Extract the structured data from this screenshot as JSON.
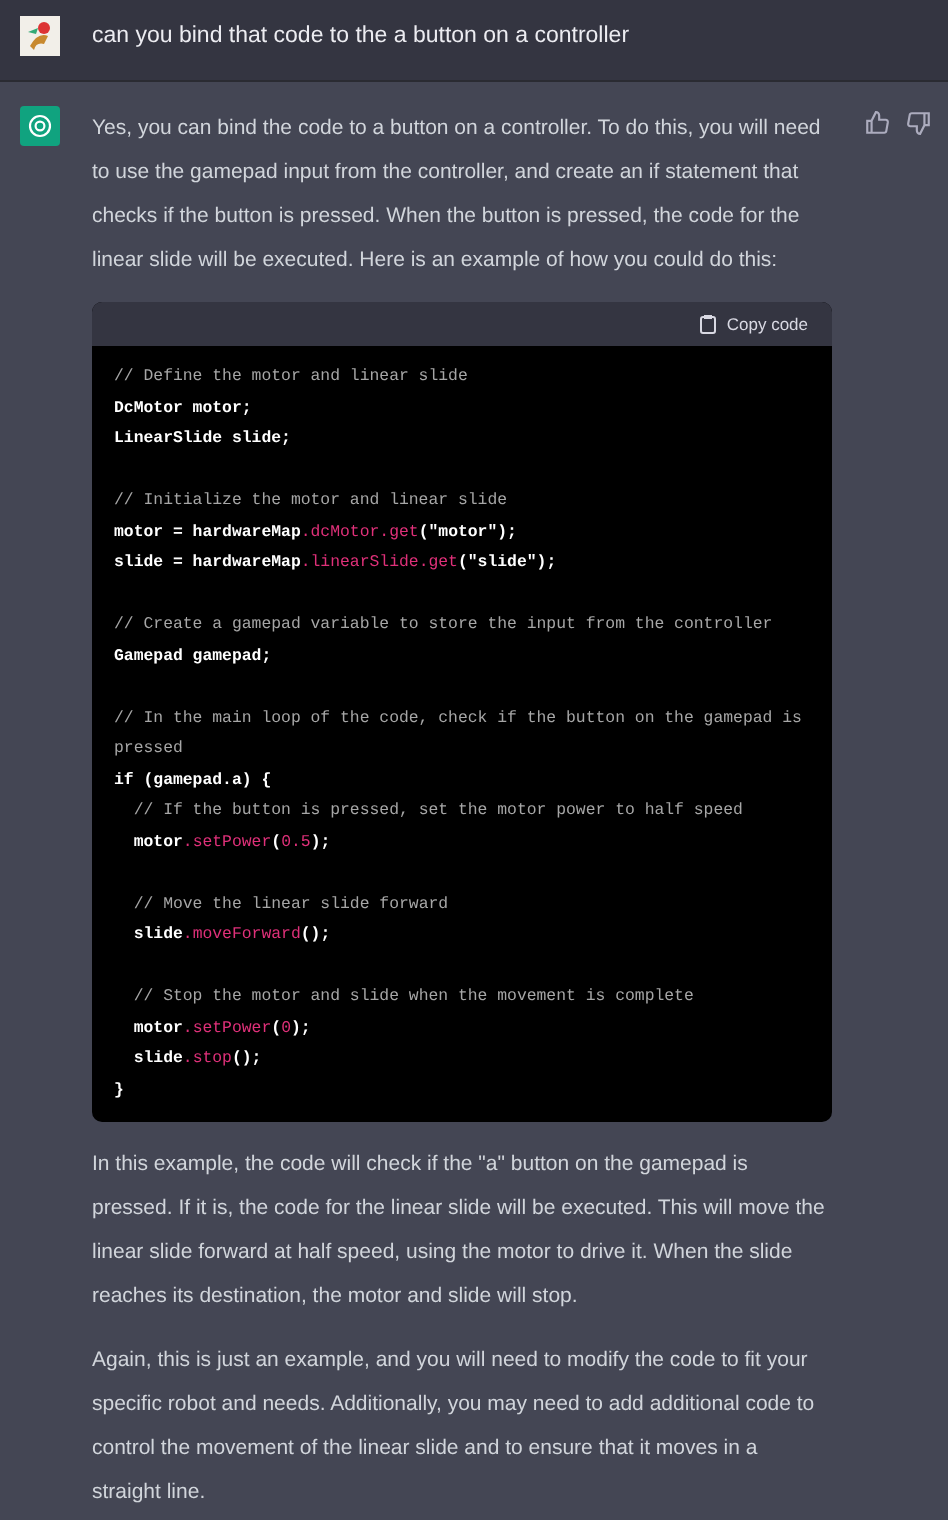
{
  "user_message": {
    "text": "can you bind that code to the a button on a controller"
  },
  "assistant_message": {
    "intro": "Yes, you can bind the code to a button on a controller. To do this, you will need to use the gamepad input from the controller, and create an if statement that checks if the button is pressed. When the button is pressed, the code for the linear slide will be executed. Here is an example of how you could do this:",
    "code_block": {
      "copy_label": "Copy code",
      "lines": [
        {
          "kind": "code",
          "segments": [
            {
              "kind": "comment",
              "text": "// Define the motor and linear slide"
            }
          ]
        },
        {
          "kind": "code",
          "segments": [
            {
              "kind": "plain",
              "text": "DcMotor motor;"
            }
          ]
        },
        {
          "kind": "code",
          "segments": [
            {
              "kind": "plain",
              "text": "LinearSlide slide;"
            }
          ]
        },
        {
          "kind": "blank"
        },
        {
          "kind": "code",
          "segments": [
            {
              "kind": "comment",
              "text": "// Initialize the motor and linear slide"
            }
          ]
        },
        {
          "kind": "code",
          "segments": [
            {
              "kind": "plain",
              "text": "motor = hardwareMap"
            },
            {
              "kind": "accent",
              "text": ".dcMotor.get"
            },
            {
              "kind": "plain",
              "text": "(\"motor\");"
            }
          ]
        },
        {
          "kind": "code",
          "segments": [
            {
              "kind": "plain",
              "text": "slide = hardwareMap"
            },
            {
              "kind": "accent",
              "text": ".linearSlide.get"
            },
            {
              "kind": "plain",
              "text": "(\"slide\");"
            }
          ]
        },
        {
          "kind": "blank"
        },
        {
          "kind": "code",
          "segments": [
            {
              "kind": "comment",
              "text": "// Create a gamepad variable to store the input from the controller"
            }
          ]
        },
        {
          "kind": "code",
          "segments": [
            {
              "kind": "plain",
              "text": "Gamepad gamepad;"
            }
          ]
        },
        {
          "kind": "blank"
        },
        {
          "kind": "code",
          "segments": [
            {
              "kind": "comment",
              "text": "// In the main loop of the code, check if the button on the gamepad is pressed"
            }
          ]
        },
        {
          "kind": "code",
          "segments": [
            {
              "kind": "plain",
              "text": "if (gamepad.a) {"
            }
          ]
        },
        {
          "kind": "code",
          "segments": [
            {
              "kind": "comment",
              "text": "  // If the button is pressed, set the motor power to half speed"
            }
          ]
        },
        {
          "kind": "code",
          "segments": [
            {
              "kind": "plain",
              "text": "  motor"
            },
            {
              "kind": "accent",
              "text": ".setPower"
            },
            {
              "kind": "plain",
              "text": "("
            },
            {
              "kind": "accent",
              "text": "0.5"
            },
            {
              "kind": "plain",
              "text": ");"
            }
          ]
        },
        {
          "kind": "blank"
        },
        {
          "kind": "code",
          "segments": [
            {
              "kind": "comment",
              "text": "  // Move the linear slide forward"
            }
          ]
        },
        {
          "kind": "code",
          "segments": [
            {
              "kind": "plain",
              "text": "  slide"
            },
            {
              "kind": "accent",
              "text": ".moveForward"
            },
            {
              "kind": "plain",
              "text": "();"
            }
          ]
        },
        {
          "kind": "blank"
        },
        {
          "kind": "code",
          "segments": [
            {
              "kind": "comment",
              "text": "  // Stop the motor and slide when the movement is complete"
            }
          ]
        },
        {
          "kind": "code",
          "segments": [
            {
              "kind": "plain",
              "text": "  motor"
            },
            {
              "kind": "accent",
              "text": ".setPower"
            },
            {
              "kind": "plain",
              "text": "("
            },
            {
              "kind": "accent",
              "text": "0"
            },
            {
              "kind": "plain",
              "text": ");"
            }
          ]
        },
        {
          "kind": "code",
          "segments": [
            {
              "kind": "plain",
              "text": "  slide"
            },
            {
              "kind": "accent",
              "text": ".stop"
            },
            {
              "kind": "plain",
              "text": "();"
            }
          ]
        },
        {
          "kind": "code",
          "segments": [
            {
              "kind": "plain",
              "text": "}"
            }
          ]
        }
      ]
    },
    "outro": [
      "In this example, the code will check if the \"a\" button on the gamepad is pressed. If it is, the code for the linear slide will be executed. This will move the linear slide forward at half speed, using the motor to drive it. When the slide reaches its destination, the motor and slide will stop.",
      "Again, this is just an example, and you will need to modify the code to fit your specific robot and needs. Additionally, you may need to add additional code to control the movement of the linear slide and to ensure that it moves in a straight line."
    ]
  }
}
